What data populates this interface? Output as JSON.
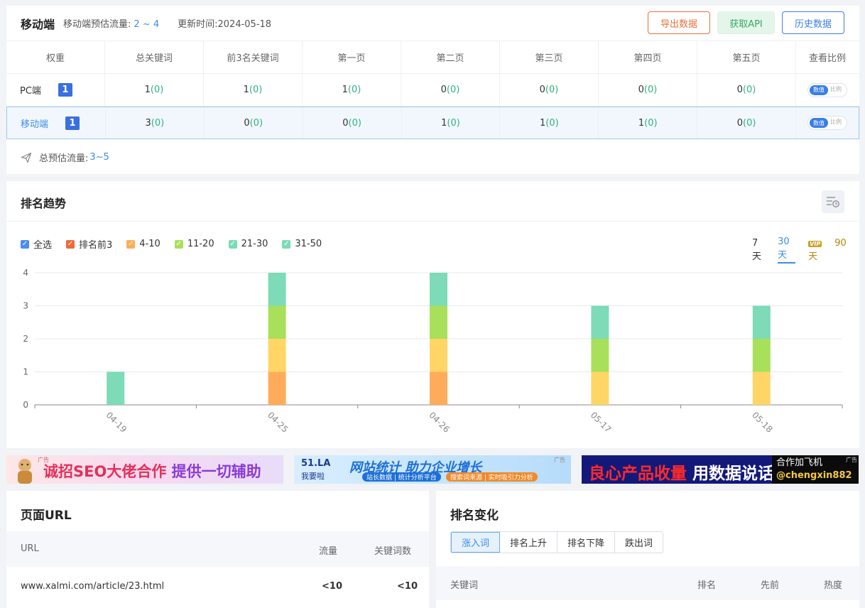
{
  "summary": {
    "title": "移动端",
    "traffic_label": "移动端预估流量:",
    "traffic_value": "2 ~ 4",
    "update_label": "更新时间:",
    "update_value": "2024-05-18",
    "export_btn": "导出数据",
    "api_btn": "获取API",
    "history_btn": "历史数据",
    "columns": [
      "权重",
      "总关键词",
      "前3名关键词",
      "第一页",
      "第二页",
      "第三页",
      "第四页",
      "第五页",
      "查看比例"
    ],
    "rows": [
      {
        "label": "PC端",
        "weight": "1",
        "vals": [
          [
            "1",
            "(0)"
          ],
          [
            "1",
            "(0)"
          ],
          [
            "1",
            "(0)"
          ],
          [
            "0",
            "(0)"
          ],
          [
            "0",
            "(0)"
          ],
          [
            "0",
            "(0)"
          ],
          [
            "0",
            "(0)"
          ]
        ],
        "toggle_on": "数值",
        "toggle_off": "比例"
      },
      {
        "label": "移动端",
        "weight": "1",
        "vals": [
          [
            "3",
            "(0)"
          ],
          [
            "0",
            "(0)"
          ],
          [
            "0",
            "(0)"
          ],
          [
            "1",
            "(0)"
          ],
          [
            "1",
            "(0)"
          ],
          [
            "1",
            "(0)"
          ],
          [
            "0",
            "(0)"
          ]
        ],
        "toggle_on": "数值",
        "toggle_off": "比例"
      }
    ],
    "total_label": "总预估流量:",
    "total_value": "3~5"
  },
  "trend": {
    "title": "排名趋势",
    "legend": [
      {
        "label": "全选",
        "color": "#4a8df0"
      },
      {
        "label": "排名前3",
        "color": "#f06a3a"
      },
      {
        "label": "4-10",
        "color": "#ffac5a"
      },
      {
        "label": "11-20",
        "color": "#a8e05a"
      },
      {
        "label": "21-30",
        "color": "#7ddbb7"
      },
      {
        "label": "31-50",
        "color": "#7ddbb7"
      }
    ],
    "range_7": "7天",
    "range_30": "30天",
    "range_90": "90天",
    "vip": "VIP"
  },
  "chart_data": {
    "type": "bar",
    "stacked": true,
    "categories": [
      "04-19",
      "04-25",
      "04-26",
      "05-17",
      "05-18"
    ],
    "series": [
      {
        "name": "4-10",
        "color": "#ffac5a",
        "values": [
          0,
          1,
          1,
          0,
          0
        ]
      },
      {
        "name": "11-20",
        "color": "#ffd666",
        "values": [
          0,
          1,
          1,
          1,
          1
        ]
      },
      {
        "name": "21-30",
        "color": "#a8e05a",
        "values": [
          0,
          1,
          1,
          1,
          1
        ]
      },
      {
        "name": "31-50",
        "color": "#7ddbb7",
        "values": [
          1,
          1,
          1,
          1,
          1
        ]
      }
    ],
    "ylim": [
      0,
      4
    ],
    "yticks": [
      0,
      1,
      2,
      3,
      4
    ],
    "grid": true
  },
  "ads": {
    "ad1_tag": "广告",
    "ad1_text1": "诚招SEO大佬合作",
    "ad1_text2": "提供一切辅助",
    "ad2_logo": "51.LA",
    "ad2_logo2": "我要啦",
    "ad2_text": "网站统计 助力企业增长",
    "ad2_sm1": "站长数据 | 统计分析平台",
    "ad2_sm2": "搜索词来源 | 实时吸引力分析",
    "ad2_tag": "广告",
    "ad3_text1": "良心产品收量",
    "ad3_text2": "用数据说话",
    "ad3_right1": "合作加飞机",
    "ad3_right2": "@chengxin882",
    "ad3_tag": "广告"
  },
  "url_panel": {
    "title": "页面URL",
    "col_url": "URL",
    "col_flow": "流量",
    "col_kw": "关键词数",
    "rows": [
      {
        "url": "www.xalmi.com/article/23.html",
        "flow": "<10",
        "kw": "<10"
      }
    ]
  },
  "rank_panel": {
    "title": "排名变化",
    "tabs": [
      "涨入词",
      "排名上升",
      "排名下降",
      "跌出词"
    ],
    "col_kw": "关键词",
    "col_rank": "排名",
    "col_prev": "先前",
    "col_heat": "热度"
  }
}
